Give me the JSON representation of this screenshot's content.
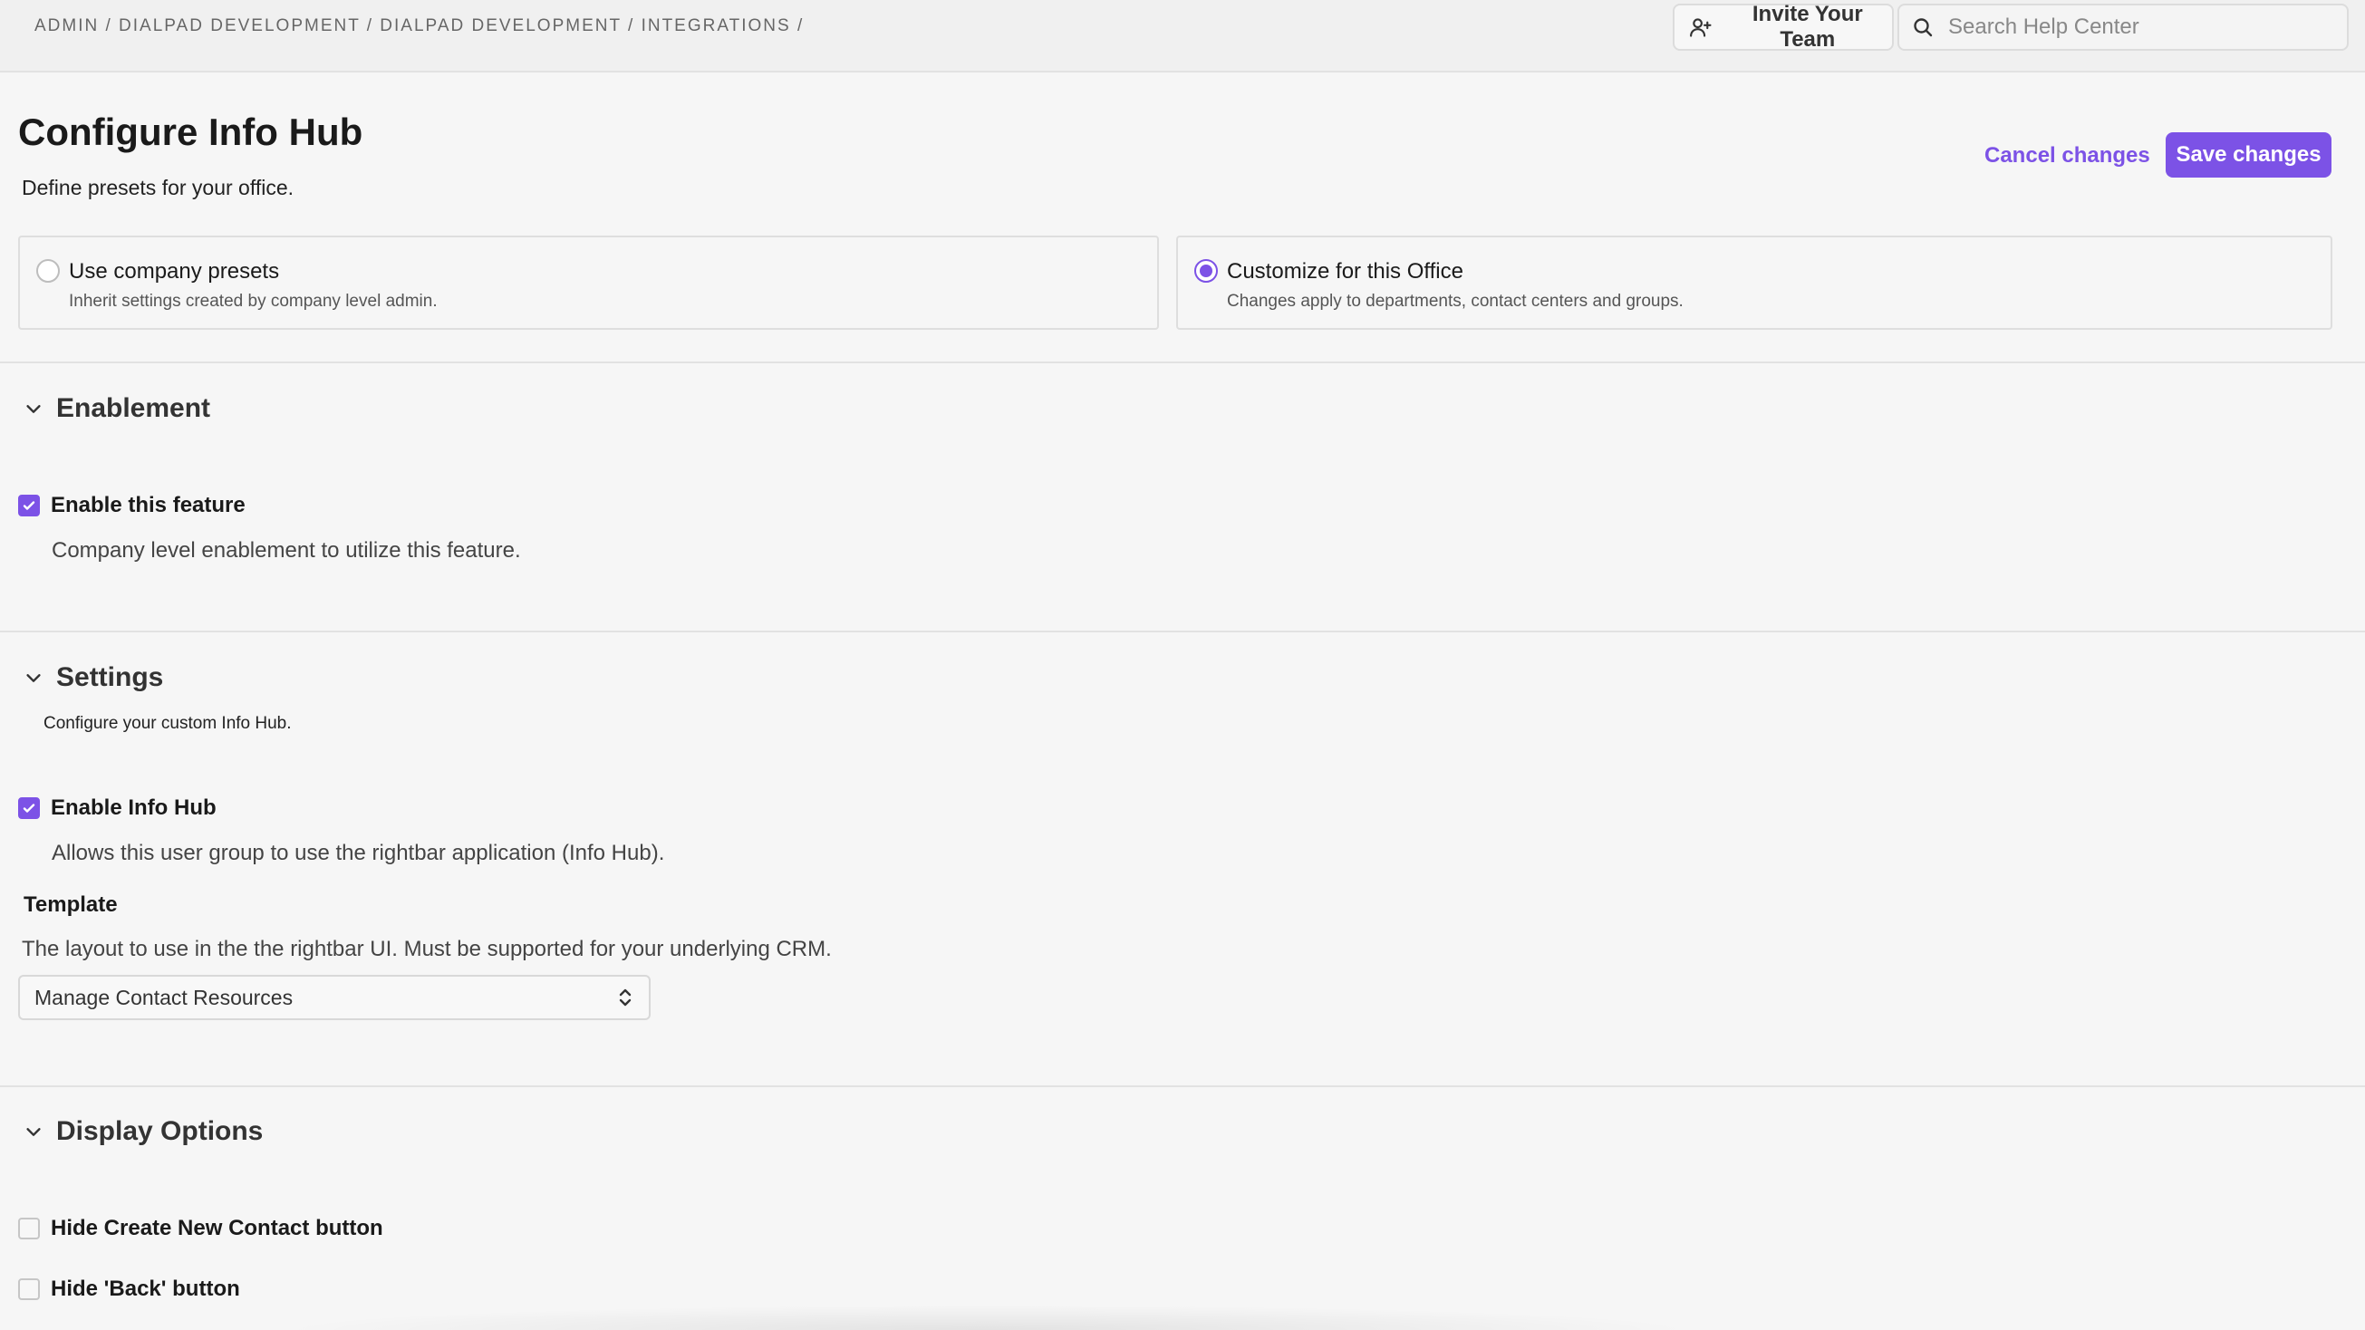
{
  "header": {
    "breadcrumb": "ADMIN / DIALPAD DEVELOPMENT / DIALPAD DEVELOPMENT / INTEGRATIONS /",
    "invite_label": "Invite Your Team",
    "search_placeholder": "Search Help Center"
  },
  "page": {
    "title": "Configure Info Hub",
    "subtitle": "Define presets for your office.",
    "cancel_label": "Cancel changes",
    "save_label": "Save changes"
  },
  "presets": [
    {
      "title": "Use company presets",
      "description": "Inherit settings created by company level admin.",
      "selected": false
    },
    {
      "title": "Customize for this Office",
      "description": "Changes apply to departments, contact centers and groups.",
      "selected": true
    }
  ],
  "enablement": {
    "heading": "Enablement",
    "checkbox_label": "Enable this feature",
    "checked": true,
    "help": "Company level enablement to utilize this feature."
  },
  "settings": {
    "heading": "Settings",
    "description": "Configure your custom Info Hub.",
    "checkbox_label": "Enable Info Hub",
    "checked": true,
    "help": "Allows this user group to use the rightbar application (Info Hub).",
    "template_label": "Template",
    "template_desc": "The layout to use in the the rightbar UI. Must be supported for your underlying CRM.",
    "template_value": "Manage Contact Resources"
  },
  "display_options": {
    "heading": "Display Options",
    "items": [
      {
        "label": "Hide Create New Contact button",
        "checked": false
      },
      {
        "label": "Hide 'Back' button",
        "checked": false
      }
    ]
  },
  "colors": {
    "accent": "#7c52e6"
  },
  "icons": [
    "add-user-icon",
    "search-icon",
    "chevron-down-icon",
    "checkmark-icon",
    "up-down-chevron-icon"
  ]
}
